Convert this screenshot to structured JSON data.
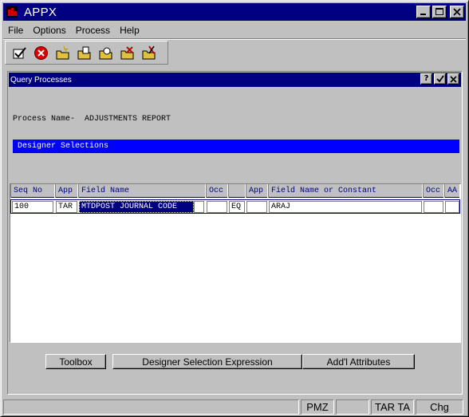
{
  "window": {
    "title": "APPX"
  },
  "menu": [
    {
      "label": "File"
    },
    {
      "label": "Options"
    },
    {
      "label": "Process"
    },
    {
      "label": "Help"
    }
  ],
  "toolbar": {
    "icons": [
      "ok-check-icon",
      "cancel-icon",
      "new-record-icon",
      "edit-record-icon",
      "find-record-icon",
      "delete-record-icon",
      "cut-record-icon"
    ]
  },
  "dialog": {
    "title": "Query Processes",
    "process_label": "Process Name-",
    "process_name": "ADJUSTMENTS REPORT",
    "section_header": "Designer Selections"
  },
  "grid": {
    "columns": [
      "Seq No",
      "App",
      "Field Name",
      "Occ",
      "",
      "App",
      "Field Name or Constant",
      "Occ",
      "AA"
    ],
    "rows": [
      {
        "seq": "100",
        "app": "TAR",
        "field": "MTDPOST JOURNAL CODE",
        "occ": "",
        "op": "EQ",
        "app2": "",
        "constant": "ARAJ",
        "occ2": "",
        "aa": ""
      }
    ]
  },
  "buttons": {
    "toolbox": "Toolbox",
    "expression": "Designer Selection Expression",
    "attributes": "Add'l Attributes"
  },
  "status": {
    "panel1": "",
    "panel2": "",
    "panel3": "PMZ",
    "panel4": "",
    "panel5": "TAR TA",
    "panel6": "Chg"
  },
  "colors": {
    "titlebar": "#000080",
    "highlight": "#0000ff",
    "chrome": "#c0c0c0"
  }
}
